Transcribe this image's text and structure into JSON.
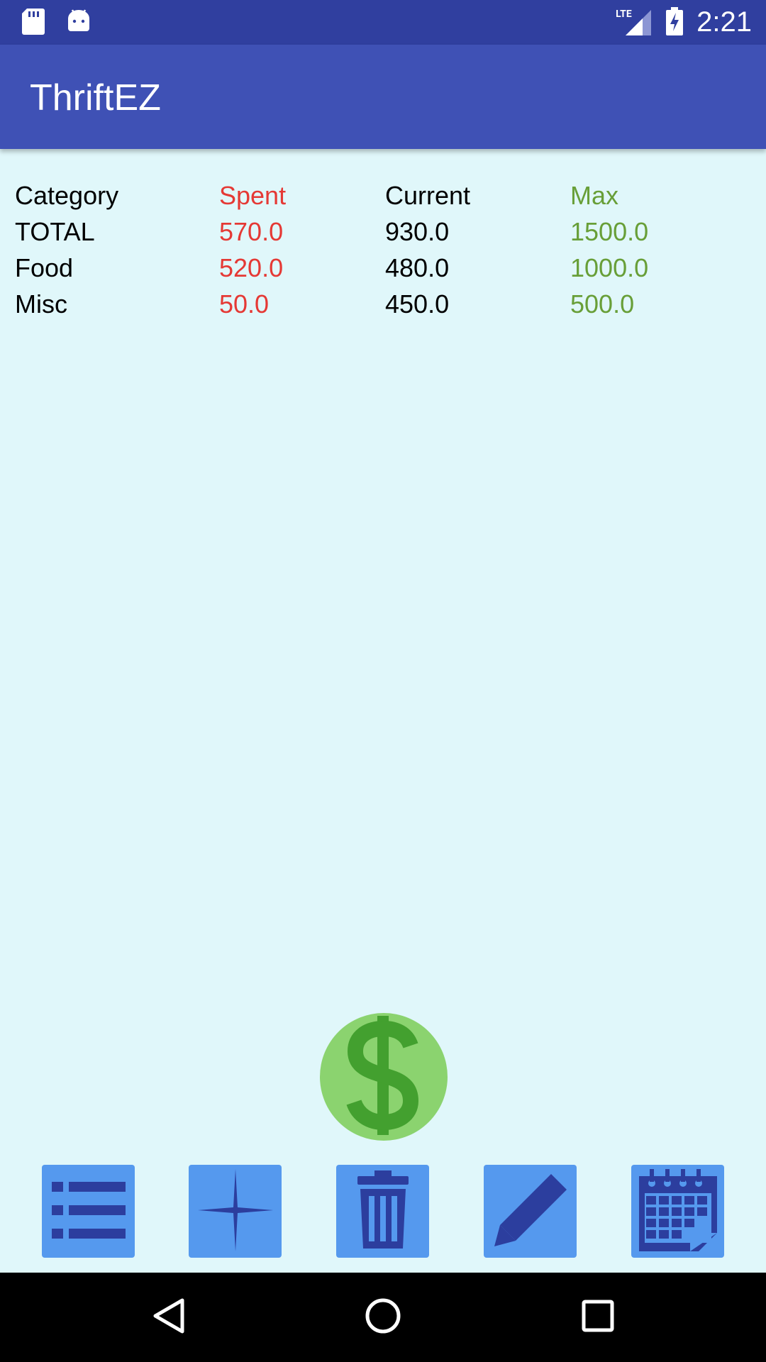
{
  "status_bar": {
    "time": "2:21",
    "network": "LTE"
  },
  "app_bar": {
    "title": "ThriftEZ"
  },
  "table": {
    "headers": [
      "Category",
      "Spent",
      "Current",
      "Max"
    ],
    "rows": [
      [
        "TOTAL",
        "570.0",
        "930.0",
        "1500.0"
      ],
      [
        "Food",
        "520.0",
        "480.0",
        "1000.0"
      ],
      [
        "Misc",
        "50.0",
        "450.0",
        "500.0"
      ]
    ]
  },
  "colors": {
    "status_bar": "#303f9f",
    "app_bar": "#3f51b5",
    "background": "#e0f7fa",
    "spent": "#e53935",
    "max": "#689f38",
    "fab": "#8bd36f",
    "tool_button": "#5599ee",
    "tool_icon": "#2c3e9e"
  },
  "fab": {
    "icon": "dollar-icon"
  },
  "toolbar": {
    "buttons": [
      {
        "name": "list-button",
        "icon": "list-icon"
      },
      {
        "name": "add-button",
        "icon": "plus-icon"
      },
      {
        "name": "delete-button",
        "icon": "trash-icon"
      },
      {
        "name": "edit-button",
        "icon": "pencil-icon"
      },
      {
        "name": "calendar-button",
        "icon": "calendar-icon"
      }
    ]
  },
  "nav_bar": {
    "buttons": [
      "back-icon",
      "home-icon",
      "recents-icon"
    ]
  }
}
